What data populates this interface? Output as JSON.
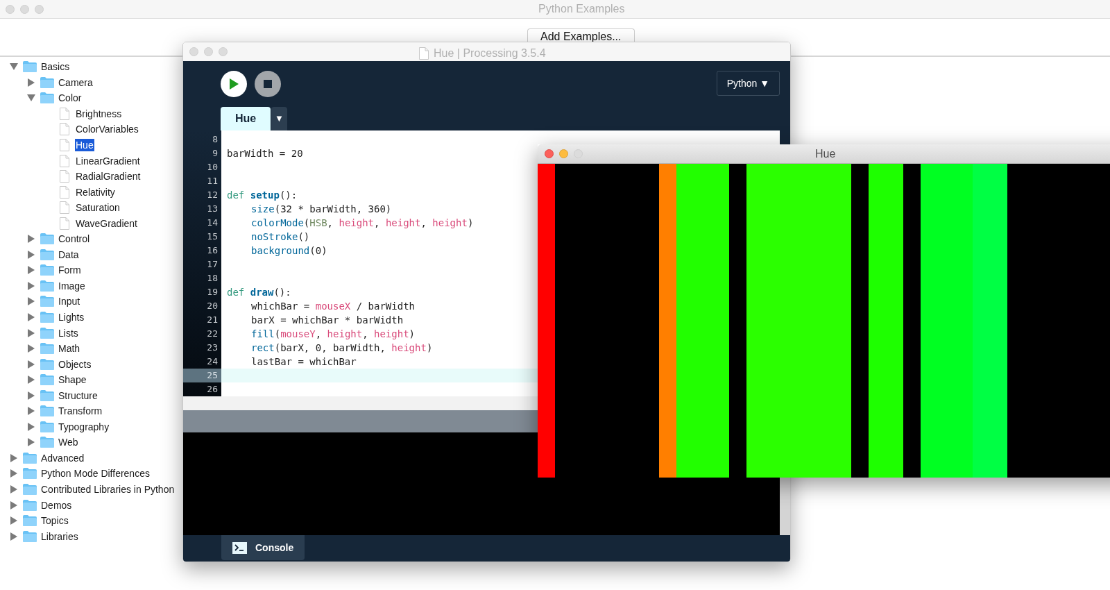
{
  "examples_window": {
    "title": "Python Examples",
    "add_button": "Add Examples...",
    "tree": [
      {
        "label": "Basics",
        "kind": "folder",
        "expanded": true,
        "selected": false,
        "children": [
          {
            "label": "Camera",
            "kind": "folder",
            "expanded": false,
            "selected": false
          },
          {
            "label": "Color",
            "kind": "folder",
            "expanded": true,
            "selected": false,
            "children": [
              {
                "label": "Brightness",
                "kind": "file",
                "selected": false
              },
              {
                "label": "ColorVariables",
                "kind": "file",
                "selected": false
              },
              {
                "label": "Hue",
                "kind": "file",
                "selected": true
              },
              {
                "label": "LinearGradient",
                "kind": "file",
                "selected": false
              },
              {
                "label": "RadialGradient",
                "kind": "file",
                "selected": false
              },
              {
                "label": "Relativity",
                "kind": "file",
                "selected": false
              },
              {
                "label": "Saturation",
                "kind": "file",
                "selected": false
              },
              {
                "label": "WaveGradient",
                "kind": "file",
                "selected": false
              }
            ]
          },
          {
            "label": "Control",
            "kind": "folder",
            "expanded": false,
            "selected": false
          },
          {
            "label": "Data",
            "kind": "folder",
            "expanded": false,
            "selected": false
          },
          {
            "label": "Form",
            "kind": "folder",
            "expanded": false,
            "selected": false
          },
          {
            "label": "Image",
            "kind": "folder",
            "expanded": false,
            "selected": false
          },
          {
            "label": "Input",
            "kind": "folder",
            "expanded": false,
            "selected": false
          },
          {
            "label": "Lights",
            "kind": "folder",
            "expanded": false,
            "selected": false
          },
          {
            "label": "Lists",
            "kind": "folder",
            "expanded": false,
            "selected": false
          },
          {
            "label": "Math",
            "kind": "folder",
            "expanded": false,
            "selected": false
          },
          {
            "label": "Objects",
            "kind": "folder",
            "expanded": false,
            "selected": false
          },
          {
            "label": "Shape",
            "kind": "folder",
            "expanded": false,
            "selected": false
          },
          {
            "label": "Structure",
            "kind": "folder",
            "expanded": false,
            "selected": false
          },
          {
            "label": "Transform",
            "kind": "folder",
            "expanded": false,
            "selected": false
          },
          {
            "label": "Typography",
            "kind": "folder",
            "expanded": false,
            "selected": false
          },
          {
            "label": "Web",
            "kind": "folder",
            "expanded": false,
            "selected": false
          }
        ]
      },
      {
        "label": "Advanced",
        "kind": "folder",
        "expanded": false,
        "selected": false
      },
      {
        "label": "Python Mode Differences",
        "kind": "folder",
        "expanded": false,
        "selected": false
      },
      {
        "label": "Contributed Libraries in Python",
        "kind": "folder",
        "expanded": false,
        "selected": false
      },
      {
        "label": "Demos",
        "kind": "folder",
        "expanded": false,
        "selected": false
      },
      {
        "label": "Topics",
        "kind": "folder",
        "expanded": false,
        "selected": false
      },
      {
        "label": "Libraries",
        "kind": "folder",
        "expanded": false,
        "selected": false
      }
    ]
  },
  "editor_window": {
    "title": "Hue | Processing 3.5.4",
    "mode": "Python ▼",
    "tabs": [
      {
        "label": "Hue",
        "selected": true
      }
    ],
    "tab_menu": "▼",
    "lines": [
      {
        "number": "8",
        "current": false
      },
      {
        "number": "9",
        "current": false,
        "tokens": [
          {
            "kind": "plain",
            "text": "barWidth = 20"
          }
        ]
      },
      {
        "number": "10",
        "current": false
      },
      {
        "number": "11",
        "current": false
      },
      {
        "number": "12",
        "current": false,
        "tokens": [
          {
            "kind": "keyword",
            "text": "def "
          },
          {
            "kind": "defname",
            "text": "setup"
          },
          {
            "kind": "plain",
            "text": "():"
          }
        ]
      },
      {
        "number": "13",
        "current": false,
        "indented": true,
        "tokens": [
          {
            "kind": "func",
            "text": "size"
          },
          {
            "kind": "plain",
            "text": "(32 * barWidth, 360)"
          }
        ]
      },
      {
        "number": "14",
        "current": false,
        "indented": true,
        "tokens": [
          {
            "kind": "func",
            "text": "colorMode"
          },
          {
            "kind": "plain",
            "text": "("
          },
          {
            "kind": "const",
            "text": "HSB"
          },
          {
            "kind": "plain",
            "text": ", "
          },
          {
            "kind": "var",
            "text": "height"
          },
          {
            "kind": "plain",
            "text": ", "
          },
          {
            "kind": "var",
            "text": "height"
          },
          {
            "kind": "plain",
            "text": ", "
          },
          {
            "kind": "var",
            "text": "height"
          },
          {
            "kind": "plain",
            "text": ")"
          }
        ]
      },
      {
        "number": "15",
        "current": false,
        "indented": true,
        "tokens": [
          {
            "kind": "func",
            "text": "noStroke"
          },
          {
            "kind": "plain",
            "text": "()"
          }
        ]
      },
      {
        "number": "16",
        "current": false,
        "indented": true,
        "tokens": [
          {
            "kind": "func",
            "text": "background"
          },
          {
            "kind": "plain",
            "text": "(0)"
          }
        ]
      },
      {
        "number": "17",
        "current": false
      },
      {
        "number": "18",
        "current": false
      },
      {
        "number": "19",
        "current": false,
        "tokens": [
          {
            "kind": "keyword",
            "text": "def "
          },
          {
            "kind": "defname",
            "text": "draw"
          },
          {
            "kind": "plain",
            "text": "():"
          }
        ]
      },
      {
        "number": "20",
        "current": false,
        "indented": true,
        "tokens": [
          {
            "kind": "plain",
            "text": "whichBar = "
          },
          {
            "kind": "var",
            "text": "mouseX"
          },
          {
            "kind": "plain",
            "text": " / barWidth"
          }
        ]
      },
      {
        "number": "21",
        "current": false,
        "indented": true,
        "tokens": [
          {
            "kind": "plain",
            "text": "barX = whichBar * barWidth"
          }
        ]
      },
      {
        "number": "22",
        "current": false,
        "indented": true,
        "tokens": [
          {
            "kind": "func",
            "text": "fill"
          },
          {
            "kind": "plain",
            "text": "("
          },
          {
            "kind": "var",
            "text": "mouseY"
          },
          {
            "kind": "plain",
            "text": ", "
          },
          {
            "kind": "var",
            "text": "height"
          },
          {
            "kind": "plain",
            "text": ", "
          },
          {
            "kind": "var",
            "text": "height"
          },
          {
            "kind": "plain",
            "text": ")"
          }
        ]
      },
      {
        "number": "23",
        "current": false,
        "indented": true,
        "tokens": [
          {
            "kind": "func",
            "text": "rect"
          },
          {
            "kind": "plain",
            "text": "(barX, 0, barWidth, "
          },
          {
            "kind": "var",
            "text": "height"
          },
          {
            "kind": "plain",
            "text": ")"
          }
        ]
      },
      {
        "number": "24",
        "current": false,
        "indented": true,
        "tokens": [
          {
            "kind": "plain",
            "text": "lastBar = whichBar"
          }
        ]
      },
      {
        "number": "25",
        "current": true
      },
      {
        "number": "26",
        "current": false
      }
    ],
    "console_tab": "Console"
  },
  "sketch_window": {
    "title": "Hue"
  }
}
